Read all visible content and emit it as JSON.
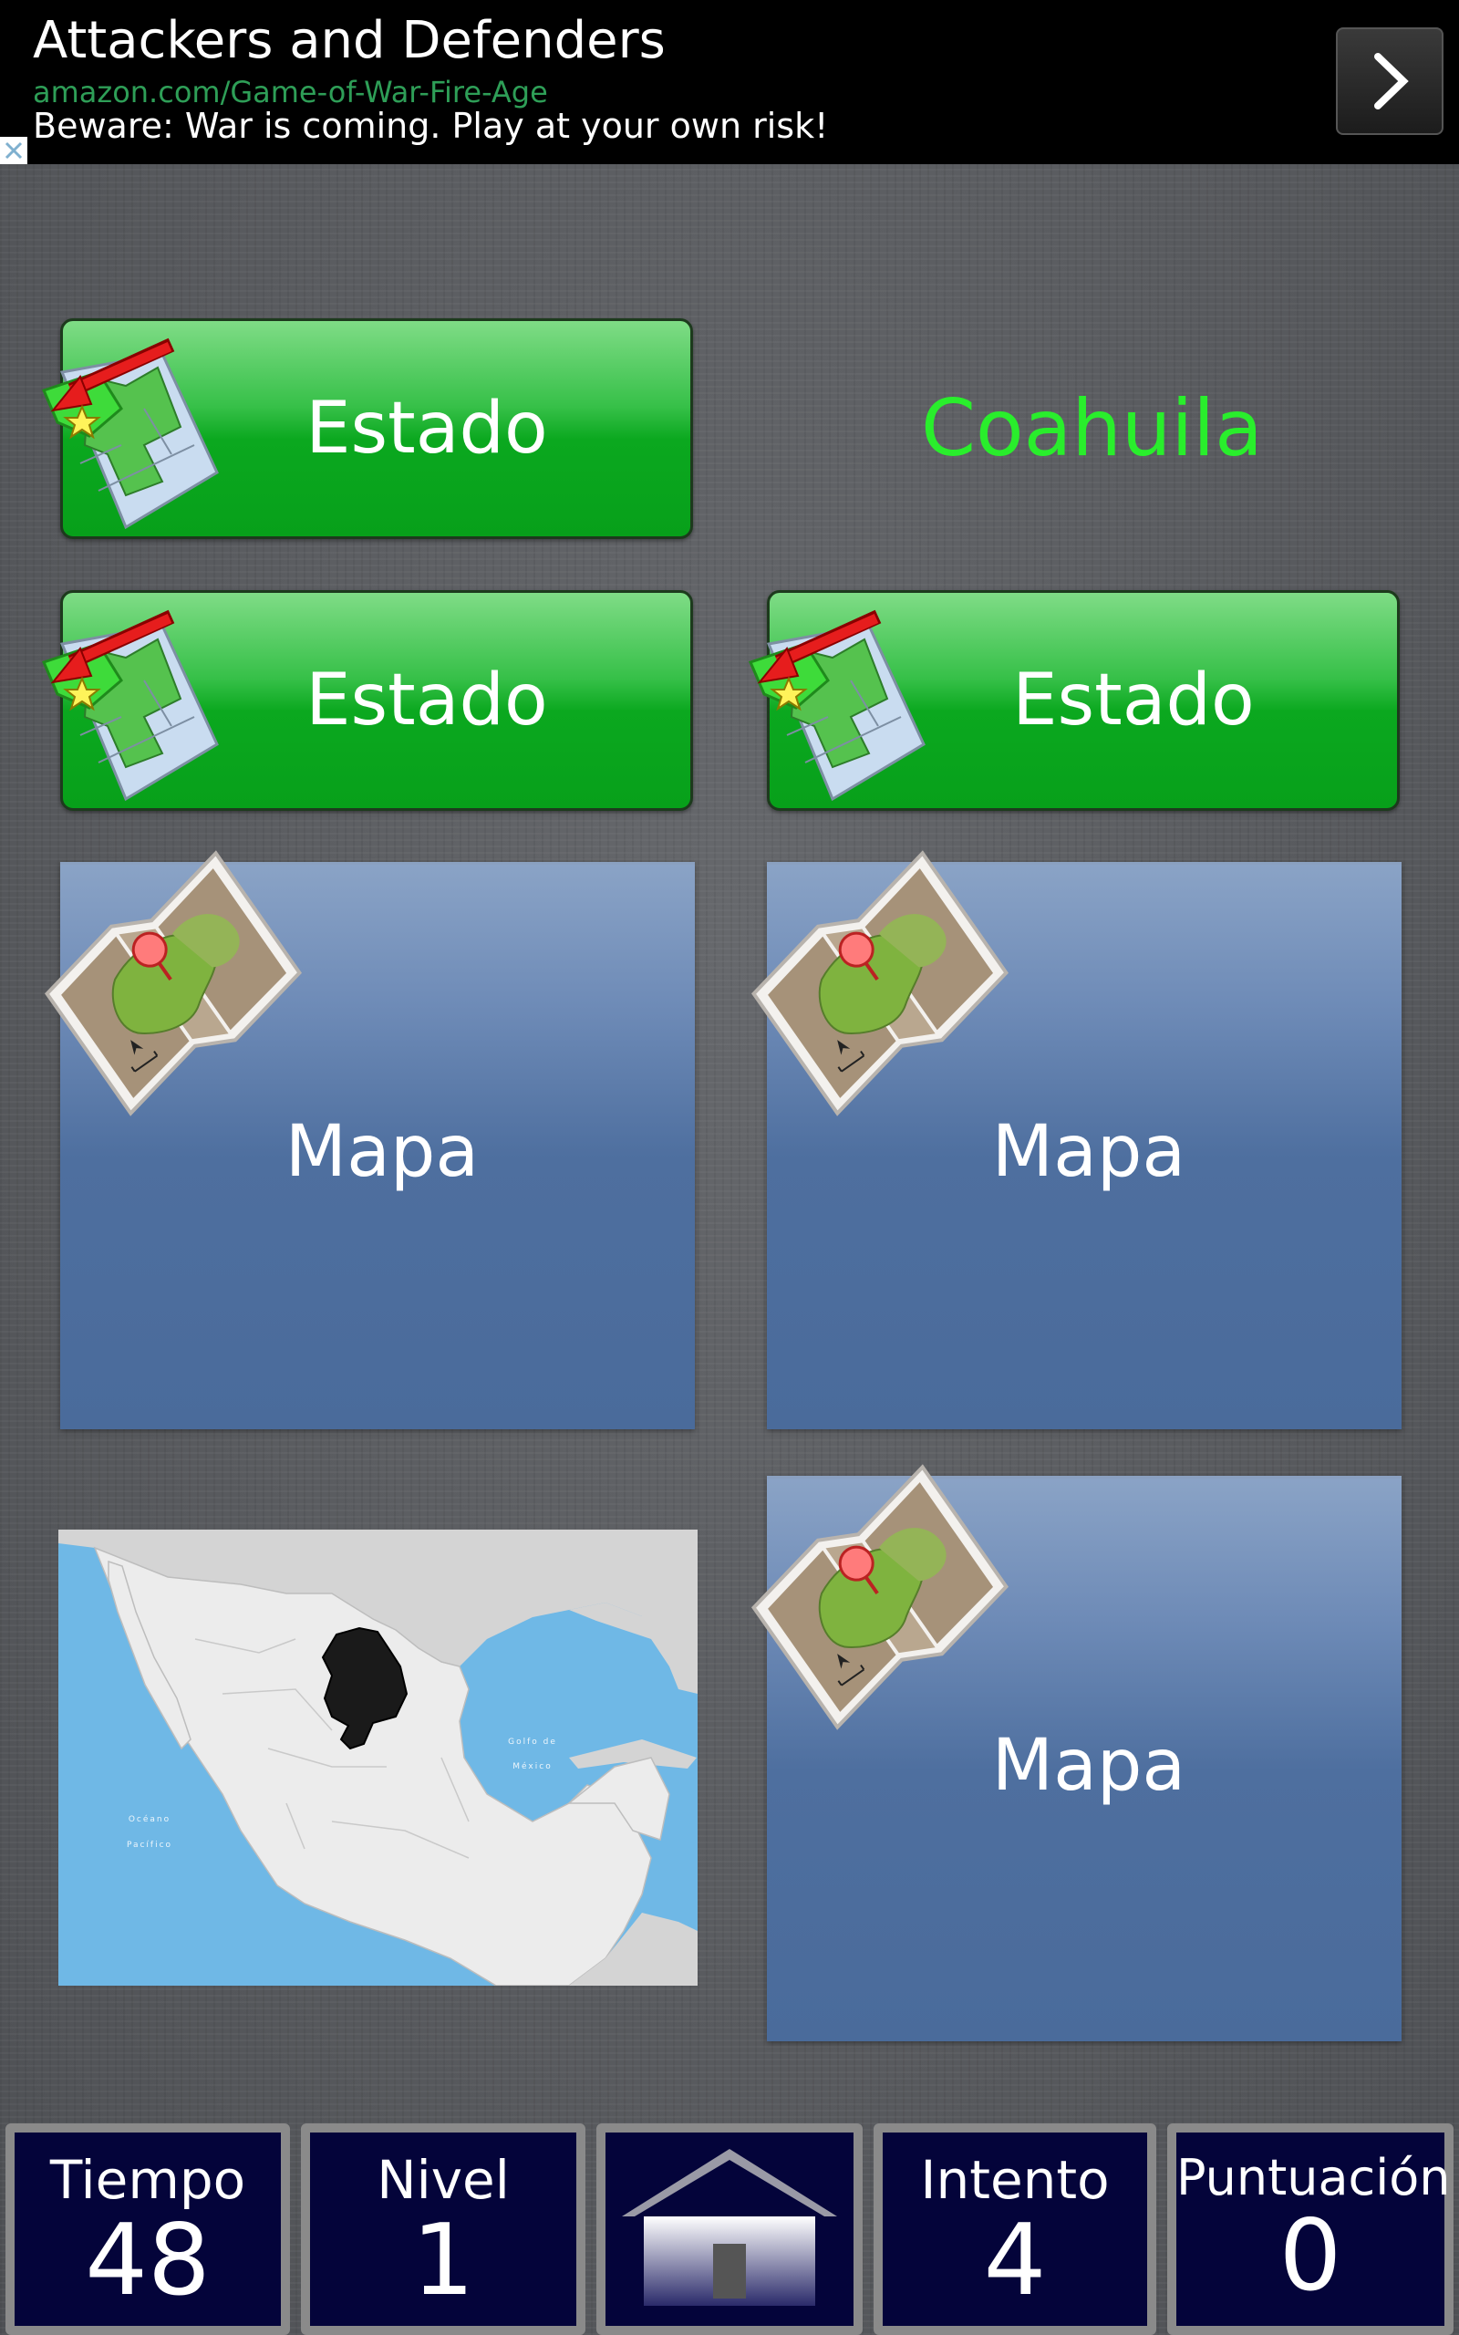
{
  "ad": {
    "title": "Attackers and Defenders",
    "url": "amazon.com/Game-of-War-Fire-Age",
    "description": "Beware: War is coming. Play at your own risk!"
  },
  "target": {
    "text": "Coahuila",
    "color": "#29ee2c"
  },
  "buttons": {
    "estado_label": "Estado",
    "mapa_label": "Mapa"
  },
  "map": {
    "gulf_label_1": "Golfo de",
    "gulf_label_2": "México",
    "ocean_label_1": "Océano",
    "ocean_label_2": "Pacífico"
  },
  "stats": {
    "time_label": "Tiempo",
    "time_value": "48",
    "level_label": "Nivel",
    "level_value": "1",
    "attempt_label": "Intento",
    "attempt_value": "4",
    "score_label": "Puntuación",
    "score_value": "0"
  },
  "colors": {
    "green_button": "#0ba81f",
    "blue_button": "#4a6b9b",
    "stat_background": "#04043a"
  }
}
